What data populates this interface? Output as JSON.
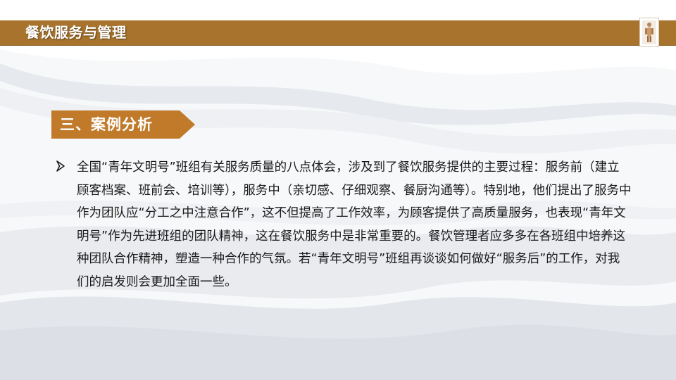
{
  "header": {
    "title": "餐饮服务与管理"
  },
  "section": {
    "label": "三、案例分析"
  },
  "content": {
    "bullet_icon": "arrow-bullet-icon",
    "paragraph": "全国“青年文明号”班组有关服务质量的八点体会，涉及到了餐饮服务提供的主要过程：服务前（建立顾客档案、班前会、培训等），服务中（亲切感、仔细观察、餐厨沟通等）。特别地，他们提出了服务中作为团队应“分工之中注意合作”，这不但提高了工作效率，为顾客提供了高质量服务，也表现“青年文明号”作为先进班组的团队精神，这在餐饮服务中是非常重要的。餐饮管理者应多多在各班组中培养这种团队合作精神，塑造一种合作的气氛。若“青年文明号”班组再谈谈如何做好“服务后”的工作，对我们的启发则会更加全面一些。"
  },
  "colors": {
    "title_bar": "#a8742d",
    "section_label": "#c17a2a",
    "text": "#1a1a1a"
  }
}
